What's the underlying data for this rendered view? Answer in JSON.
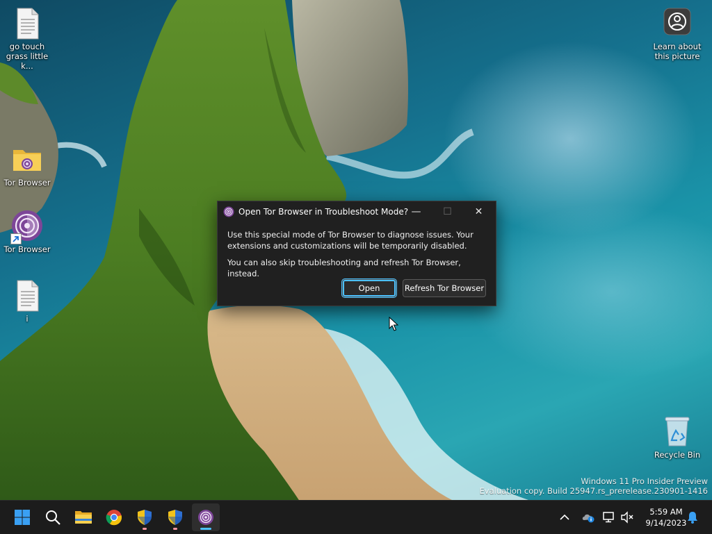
{
  "desktop": {
    "icons": [
      {
        "name": "desktop-icon-text-file-go-touch-grass",
        "label": "go touch grass little k...",
        "icon": "text-file-icon"
      },
      {
        "name": "desktop-icon-tor-browser-folder",
        "label": "Tor Browser",
        "icon": "folder-icon"
      },
      {
        "name": "desktop-icon-tor-browser-shortcut",
        "label": "Tor Browser",
        "icon": "tor-browser-icon"
      },
      {
        "name": "desktop-icon-text-file-i",
        "label": "i",
        "icon": "text-file-icon"
      },
      {
        "name": "desktop-icon-learn-about-picture",
        "label": "Learn about this picture",
        "icon": "camera-icon"
      },
      {
        "name": "desktop-icon-recycle-bin",
        "label": "Recycle Bin",
        "icon": "recycle-bin-icon"
      }
    ],
    "watermark": {
      "line1": "Windows 11 Pro Insider Preview",
      "line2": "Evaluation copy. Build 25947.rs_prerelease.230901-1416"
    }
  },
  "dialog": {
    "title": "Open Tor Browser in Troubleshoot Mode?",
    "message1": "Use this special mode of Tor Browser to diagnose issues. Your extensions and customizations will be temporarily disabled.",
    "message2": "You can also skip troubleshooting and refresh Tor Browser, instead.",
    "open_label": "Open",
    "refresh_label": "Refresh Tor Browser",
    "controls": {
      "minimize": "—",
      "maximize": "☐",
      "close": "✕"
    }
  },
  "taskbar": {
    "items": [
      {
        "name": "start",
        "icon": "windows-start-icon"
      },
      {
        "name": "search",
        "icon": "search-icon"
      },
      {
        "name": "file-explorer",
        "icon": "folder-icon"
      },
      {
        "name": "chrome",
        "icon": "chrome-icon"
      },
      {
        "name": "security-shield-1",
        "icon": "uac-shield-icon"
      },
      {
        "name": "security-shield-2",
        "icon": "uac-shield-icon"
      },
      {
        "name": "tor-browser",
        "icon": "tor-browser-icon",
        "active": true
      }
    ],
    "tray": {
      "time": "5:59 AM",
      "date": "9/14/2023"
    }
  },
  "colors": {
    "accent": "#4cc2ff",
    "tor_purple": "#7d4698",
    "taskbar_bg": "#1c1c1c",
    "dialog_bg": "#202020"
  }
}
